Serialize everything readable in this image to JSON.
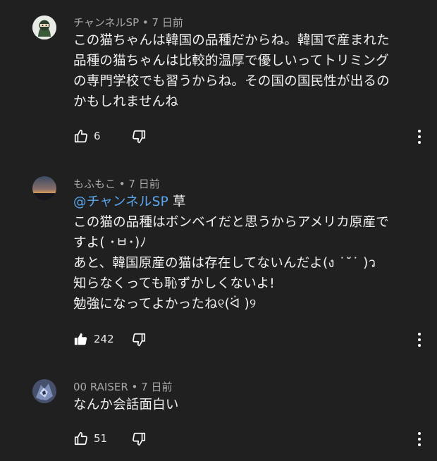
{
  "comments": [
    {
      "author": "チャンネルSP",
      "time": "7 日前",
      "lines": [
        "この猫ちゃんは韓国の品種だからね。韓国で産まれた",
        "品種の猫ちゃんは比較的温厚で優しいってトリミング",
        "の専門学校でも習うからね。その国の国民性が出るの",
        "かもしれませんね"
      ],
      "likes": "6",
      "liked": false,
      "avatar_icon": "ninja-avatar-icon"
    },
    {
      "author": "もふもこ",
      "time": "7 日前",
      "mention": "@チャンネルSP",
      "mention_tail": " 草",
      "lines": [
        "この猫の品種はボンベイだと思うからアメリカ原産で",
        "すよ( ･ㅂ･)ﾉ",
        "あと、韓国原産の猫は存在してないんだよ(ง ˙˘˙ )ว",
        "知らなくっても恥ずかしくないよ!",
        "勉強になってよかったね୧(ᐛ )୨"
      ],
      "likes": "242",
      "liked": true,
      "avatar_icon": "sunset-avatar-icon"
    },
    {
      "author": "00 RAISER",
      "time": "7 日前",
      "lines": [
        "なんか会話面白い"
      ],
      "likes": "51",
      "liked": false,
      "avatar_icon": "robot-avatar-icon"
    }
  ],
  "separator": " • ",
  "colors": {
    "background": "#202020",
    "meta": "#a8a8a8",
    "mention": "#5aa7f0"
  }
}
